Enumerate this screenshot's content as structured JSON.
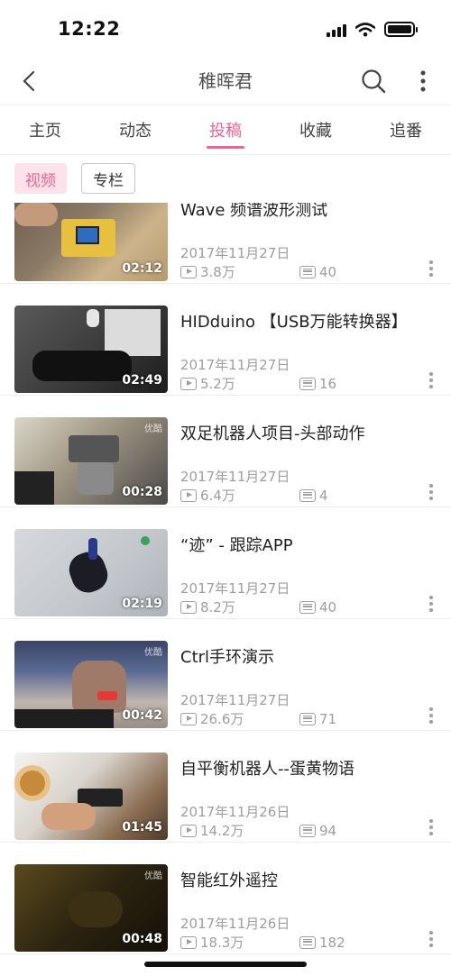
{
  "status_bar": {
    "time": "12:22"
  },
  "header": {
    "title": "稚晖君",
    "back_icon": "chevron-left-icon",
    "search_icon": "search-icon",
    "more_icon": "more-vertical-icon"
  },
  "tabs": [
    {
      "label": "主页"
    },
    {
      "label": "动态"
    },
    {
      "label": "投稿",
      "active": true
    },
    {
      "label": "收藏"
    },
    {
      "label": "追番"
    }
  ],
  "filters": [
    {
      "label": "视频",
      "active": true
    },
    {
      "label": "专栏",
      "active": false
    }
  ],
  "videos": [
    {
      "title": "Wave 频谱波形测试",
      "duration": "02:12",
      "date": "2017年11月27日",
      "views": "3.8万",
      "danmaku": "40"
    },
    {
      "title": "HIDduino 【USB万能转换器】",
      "duration": "02:49",
      "date": "2017年11月27日",
      "views": "5.2万",
      "danmaku": "16"
    },
    {
      "title": "双足机器人项目-头部动作",
      "duration": "00:28",
      "date": "2017年11月27日",
      "views": "6.4万",
      "danmaku": "4"
    },
    {
      "title": "“迹” - 跟踪APP",
      "duration": "02:19",
      "date": "2017年11月27日",
      "views": "8.2万",
      "danmaku": "40"
    },
    {
      "title": "Ctrl手环演示",
      "duration": "00:42",
      "date": "2017年11月27日",
      "views": "26.6万",
      "danmaku": "71"
    },
    {
      "title": "自平衡机器人--蛋黄物语",
      "duration": "01:45",
      "date": "2017年11月26日",
      "views": "14.2万",
      "danmaku": "94"
    },
    {
      "title": "智能红外遥控",
      "duration": "00:48",
      "date": "2017年11月26日",
      "views": "18.3万",
      "danmaku": "182"
    }
  ],
  "colors": {
    "accent": "#f06292",
    "accent_bg": "#fde2ec",
    "meta_text": "#9e9e9e"
  }
}
